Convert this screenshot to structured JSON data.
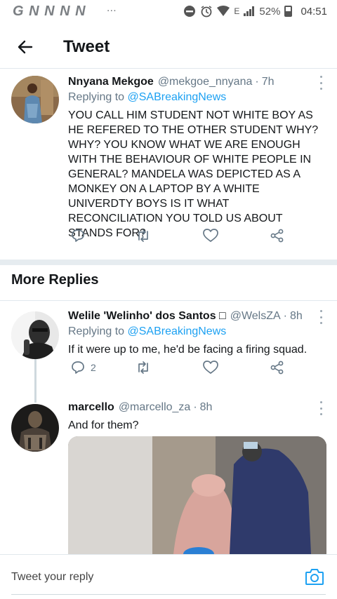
{
  "status_bar": {
    "carrier_icons": "G N N N N",
    "dots": "···",
    "network": "E",
    "battery": "52%",
    "time": "04:51"
  },
  "header": {
    "title": "Tweet"
  },
  "tweets": [
    {
      "name": "Nnyana Mekgoe",
      "handle": "@mekgoe_nnyana",
      "sep": "·",
      "ago": "7h",
      "replying_prefix": "Replying to ",
      "replying_to": "@SABreakingNews",
      "text": "YOU CALL HIM STUDENT NOT WHITE BOY AS HE REFERED TO THE OTHER STUDENT WHY?WHY? YOU KNOW WHAT WE ARE ENOUGH WITH THE BEHAVIOUR OF WHITE PEOPLE IN GENERAL? MANDELA WAS DEPICTED AS A MONKEY ON A LAPTOP BY A WHITE UNIVERDTY BOYS IS IT WHAT RECONCILIATION YOU TOLD US ABOUT STANDS FOR?"
    },
    {
      "name": "Welile 'Welinho' dos Santos □",
      "handle": "@WelsZA",
      "sep": "·",
      "ago": "8h",
      "replying_prefix": "Replying to ",
      "replying_to": "@SABreakingNews",
      "text": "If it were up to me, he'd be facing a firing squad.",
      "reply_count": "2"
    },
    {
      "name": "marcello",
      "handle": "@marcello_za",
      "sep": "·",
      "ago": "8h",
      "text": "And for them?"
    }
  ],
  "sections": {
    "more_replies": "More Replies"
  },
  "compose": {
    "placeholder": "Tweet your reply"
  },
  "colors": {
    "accent": "#1da1f2",
    "secondary_text": "#657786",
    "divider": "#e6ecf0"
  },
  "icons": [
    "back-arrow-icon",
    "reply-icon",
    "retweet-icon",
    "like-icon",
    "share-icon",
    "more-icon",
    "camera-icon"
  ]
}
